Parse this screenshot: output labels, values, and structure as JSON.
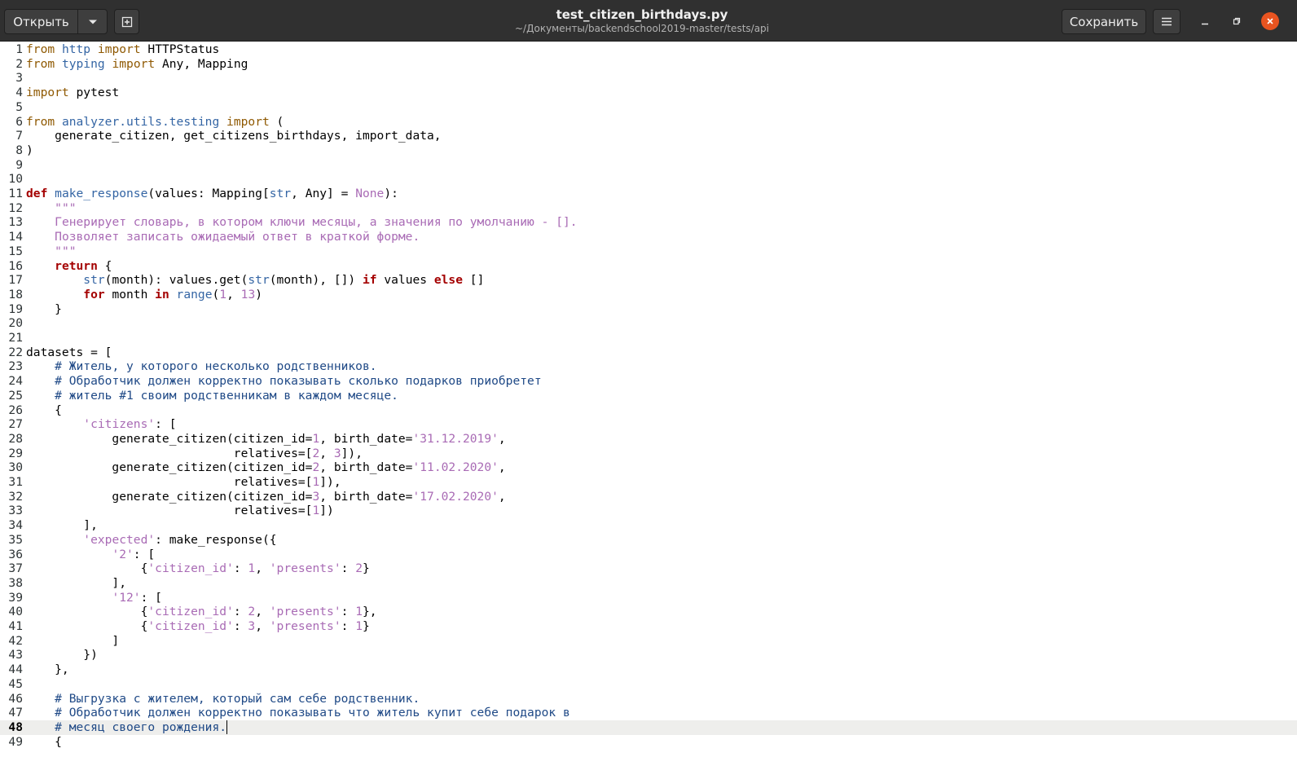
{
  "toolbar": {
    "open_label": "Открыть",
    "save_label": "Сохранить"
  },
  "window": {
    "title": "test_citizen_birthdays.py",
    "path": "~/Документы/backendschool2019-master/tests/api"
  },
  "editor": {
    "current_line": 48,
    "lines": [
      {
        "n": "1",
        "t": [
          [
            "k",
            "from"
          ],
          [
            "p",
            " "
          ],
          [
            "m",
            "http"
          ],
          [
            "p",
            " "
          ],
          [
            "k",
            "import"
          ],
          [
            "p",
            " HTTPStatus"
          ]
        ]
      },
      {
        "n": "2",
        "t": [
          [
            "k",
            "from"
          ],
          [
            "p",
            " "
          ],
          [
            "m",
            "typing"
          ],
          [
            "p",
            " "
          ],
          [
            "k",
            "import"
          ],
          [
            "p",
            " Any, Mapping"
          ]
        ]
      },
      {
        "n": "3",
        "t": []
      },
      {
        "n": "4",
        "t": [
          [
            "k",
            "import"
          ],
          [
            "p",
            " pytest"
          ]
        ]
      },
      {
        "n": "5",
        "t": []
      },
      {
        "n": "6",
        "t": [
          [
            "k",
            "from"
          ],
          [
            "p",
            " "
          ],
          [
            "m",
            "analyzer.utils.testing"
          ],
          [
            "p",
            " "
          ],
          [
            "k",
            "import"
          ],
          [
            "p",
            " ("
          ]
        ]
      },
      {
        "n": "7",
        "t": [
          [
            "p",
            "    generate_citizen, get_citizens_birthdays, import_data,"
          ]
        ]
      },
      {
        "n": "8",
        "t": [
          [
            "p",
            ")"
          ]
        ]
      },
      {
        "n": "9",
        "t": []
      },
      {
        "n": "10",
        "t": []
      },
      {
        "n": "11",
        "t": [
          [
            "K",
            "def"
          ],
          [
            "p",
            " "
          ],
          [
            "f",
            "make_response"
          ],
          [
            "p",
            "(values: Mapping["
          ],
          [
            "b",
            "str"
          ],
          [
            "p",
            ", Any] = "
          ],
          [
            "s",
            "None"
          ],
          [
            "p",
            "):"
          ]
        ]
      },
      {
        "n": "12",
        "t": [
          [
            "p",
            "    "
          ],
          [
            "d",
            "\"\"\""
          ]
        ]
      },
      {
        "n": "13",
        "t": [
          [
            "p",
            "    "
          ],
          [
            "d",
            "Генерирует словарь, в котором ключи месяцы, а значения по умолчанию - []."
          ]
        ]
      },
      {
        "n": "14",
        "t": [
          [
            "p",
            "    "
          ],
          [
            "d",
            "Позволяет записать ожидаемый ответ в краткой форме."
          ]
        ]
      },
      {
        "n": "15",
        "t": [
          [
            "p",
            "    "
          ],
          [
            "d",
            "\"\"\""
          ]
        ]
      },
      {
        "n": "16",
        "t": [
          [
            "p",
            "    "
          ],
          [
            "K",
            "return"
          ],
          [
            "p",
            " {"
          ]
        ]
      },
      {
        "n": "17",
        "t": [
          [
            "p",
            "        "
          ],
          [
            "b",
            "str"
          ],
          [
            "p",
            "(month): values.get("
          ],
          [
            "b",
            "str"
          ],
          [
            "p",
            "(month), []) "
          ],
          [
            "K",
            "if"
          ],
          [
            "p",
            " values "
          ],
          [
            "K",
            "else"
          ],
          [
            "p",
            " []"
          ]
        ]
      },
      {
        "n": "18",
        "t": [
          [
            "p",
            "        "
          ],
          [
            "K",
            "for"
          ],
          [
            "p",
            " month "
          ],
          [
            "K",
            "in"
          ],
          [
            "p",
            " "
          ],
          [
            "b",
            "range"
          ],
          [
            "p",
            "("
          ],
          [
            "s",
            "1"
          ],
          [
            "p",
            ", "
          ],
          [
            "s",
            "13"
          ],
          [
            "p",
            ")"
          ]
        ]
      },
      {
        "n": "19",
        "t": [
          [
            "p",
            "    }"
          ]
        ]
      },
      {
        "n": "20",
        "t": []
      },
      {
        "n": "21",
        "t": []
      },
      {
        "n": "22",
        "t": [
          [
            "p",
            "datasets = ["
          ]
        ]
      },
      {
        "n": "23",
        "t": [
          [
            "p",
            "    "
          ],
          [
            "c",
            "# Житель, у которого несколько родственников."
          ]
        ]
      },
      {
        "n": "24",
        "t": [
          [
            "p",
            "    "
          ],
          [
            "c",
            "# Обработчик должен корректно показывать сколько подарков приобретет"
          ]
        ]
      },
      {
        "n": "25",
        "t": [
          [
            "p",
            "    "
          ],
          [
            "c",
            "# житель #1 своим родственникам в каждом месяце."
          ]
        ]
      },
      {
        "n": "26",
        "t": [
          [
            "p",
            "    {"
          ]
        ]
      },
      {
        "n": "27",
        "t": [
          [
            "p",
            "        "
          ],
          [
            "s",
            "'citizens'"
          ],
          [
            "p",
            ": ["
          ]
        ]
      },
      {
        "n": "28",
        "t": [
          [
            "p",
            "            generate_citizen(citizen_id="
          ],
          [
            "s",
            "1"
          ],
          [
            "p",
            ", birth_date="
          ],
          [
            "s",
            "'31.12.2019'"
          ],
          [
            "p",
            ","
          ]
        ]
      },
      {
        "n": "29",
        "t": [
          [
            "p",
            "                             relatives=["
          ],
          [
            "s",
            "2"
          ],
          [
            "p",
            ", "
          ],
          [
            "s",
            "3"
          ],
          [
            "p",
            "]),"
          ]
        ]
      },
      {
        "n": "30",
        "t": [
          [
            "p",
            "            generate_citizen(citizen_id="
          ],
          [
            "s",
            "2"
          ],
          [
            "p",
            ", birth_date="
          ],
          [
            "s",
            "'11.02.2020'"
          ],
          [
            "p",
            ","
          ]
        ]
      },
      {
        "n": "31",
        "t": [
          [
            "p",
            "                             relatives=["
          ],
          [
            "s",
            "1"
          ],
          [
            "p",
            "]),"
          ]
        ]
      },
      {
        "n": "32",
        "t": [
          [
            "p",
            "            generate_citizen(citizen_id="
          ],
          [
            "s",
            "3"
          ],
          [
            "p",
            ", birth_date="
          ],
          [
            "s",
            "'17.02.2020'"
          ],
          [
            "p",
            ","
          ]
        ]
      },
      {
        "n": "33",
        "t": [
          [
            "p",
            "                             relatives=["
          ],
          [
            "s",
            "1"
          ],
          [
            "p",
            "])"
          ]
        ]
      },
      {
        "n": "34",
        "t": [
          [
            "p",
            "        ],"
          ]
        ]
      },
      {
        "n": "35",
        "t": [
          [
            "p",
            "        "
          ],
          [
            "s",
            "'expected'"
          ],
          [
            "p",
            ": make_response({"
          ]
        ]
      },
      {
        "n": "36",
        "t": [
          [
            "p",
            "            "
          ],
          [
            "s",
            "'2'"
          ],
          [
            "p",
            ": ["
          ]
        ]
      },
      {
        "n": "37",
        "t": [
          [
            "p",
            "                {"
          ],
          [
            "s",
            "'citizen_id'"
          ],
          [
            "p",
            ": "
          ],
          [
            "s",
            "1"
          ],
          [
            "p",
            ", "
          ],
          [
            "s",
            "'presents'"
          ],
          [
            "p",
            ": "
          ],
          [
            "s",
            "2"
          ],
          [
            "p",
            "}"
          ]
        ]
      },
      {
        "n": "38",
        "t": [
          [
            "p",
            "            ],"
          ]
        ]
      },
      {
        "n": "39",
        "t": [
          [
            "p",
            "            "
          ],
          [
            "s",
            "'12'"
          ],
          [
            "p",
            ": ["
          ]
        ]
      },
      {
        "n": "40",
        "t": [
          [
            "p",
            "                {"
          ],
          [
            "s",
            "'citizen_id'"
          ],
          [
            "p",
            ": "
          ],
          [
            "s",
            "2"
          ],
          [
            "p",
            ", "
          ],
          [
            "s",
            "'presents'"
          ],
          [
            "p",
            ": "
          ],
          [
            "s",
            "1"
          ],
          [
            "p",
            "},"
          ]
        ]
      },
      {
        "n": "41",
        "t": [
          [
            "p",
            "                {"
          ],
          [
            "s",
            "'citizen_id'"
          ],
          [
            "p",
            ": "
          ],
          [
            "s",
            "3"
          ],
          [
            "p",
            ", "
          ],
          [
            "s",
            "'presents'"
          ],
          [
            "p",
            ": "
          ],
          [
            "s",
            "1"
          ],
          [
            "p",
            "}"
          ]
        ]
      },
      {
        "n": "42",
        "t": [
          [
            "p",
            "            ]"
          ]
        ]
      },
      {
        "n": "43",
        "t": [
          [
            "p",
            "        })"
          ]
        ]
      },
      {
        "n": "44",
        "t": [
          [
            "p",
            "    },"
          ]
        ]
      },
      {
        "n": "45",
        "t": []
      },
      {
        "n": "46",
        "t": [
          [
            "p",
            "    "
          ],
          [
            "c",
            "# Выгрузка с жителем, который сам себе родственник."
          ]
        ]
      },
      {
        "n": "47",
        "t": [
          [
            "p",
            "    "
          ],
          [
            "c",
            "# Обработчик должен корректно показывать что житель купит себе подарок в"
          ]
        ]
      },
      {
        "n": "48",
        "t": [
          [
            "p",
            "    "
          ],
          [
            "c",
            "# месяц своего рождения."
          ]
        ]
      },
      {
        "n": "49",
        "t": [
          [
            "p",
            "    {"
          ]
        ]
      }
    ]
  }
}
